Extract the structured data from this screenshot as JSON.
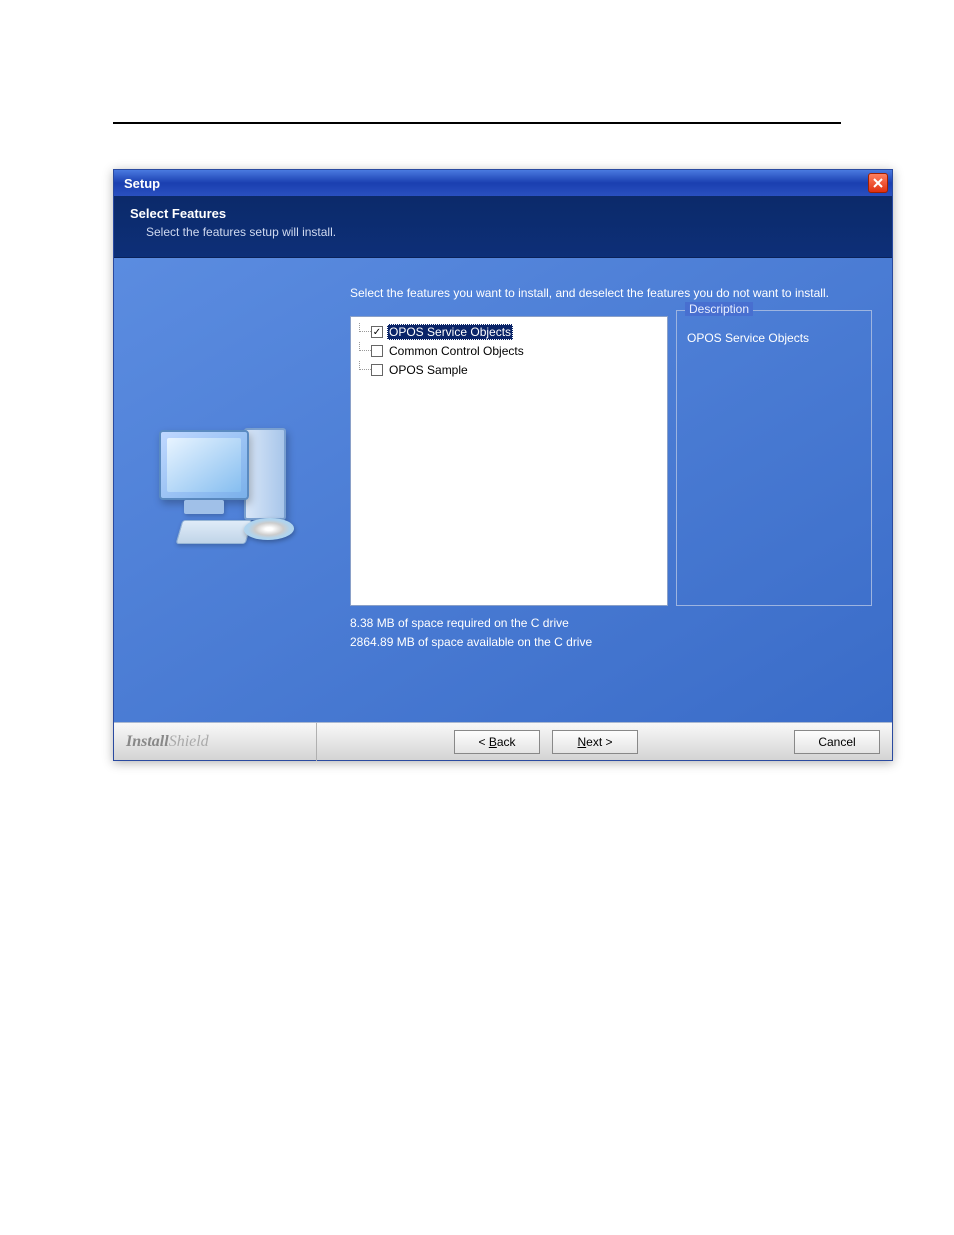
{
  "titlebar": {
    "title": "Setup"
  },
  "header": {
    "title": "Select Features",
    "subtitle": "Select the features setup will install."
  },
  "body": {
    "instruction": "Select the features you want to install, and deselect the features you do not want to install.",
    "features": [
      {
        "label": "OPOS Service Objects",
        "checked": true,
        "selected": true
      },
      {
        "label": "Common Control Objects",
        "checked": false,
        "selected": false
      },
      {
        "label": "OPOS Sample",
        "checked": false,
        "selected": false
      }
    ],
    "description_legend": "Description",
    "description_text": "OPOS Service Objects",
    "space_required": "8.38 MB of space required on the C drive",
    "space_available": "2864.89 MB of space available on the C drive"
  },
  "footer": {
    "brand_bold": "Install",
    "brand_light": "Shield",
    "back_label": "< Back",
    "next_label": "Next >",
    "cancel_label": "Cancel"
  }
}
